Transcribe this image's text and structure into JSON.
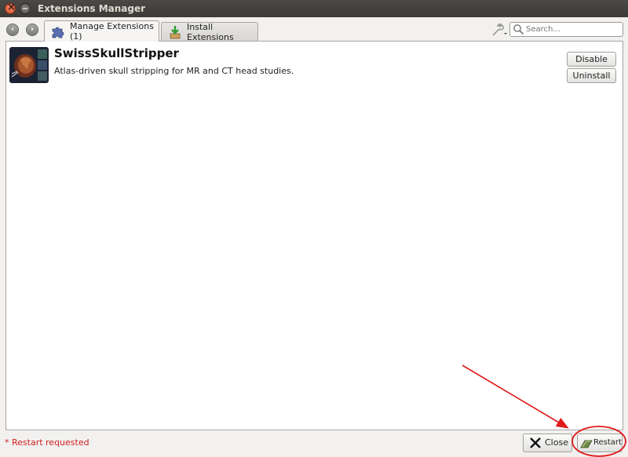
{
  "window": {
    "title": "Extensions Manager"
  },
  "tabs": [
    {
      "label": "Manage Extensions (1)",
      "icon": "puzzle-icon",
      "active": true
    },
    {
      "label": "Install Extensions",
      "icon": "install-icon",
      "active": false
    }
  ],
  "search": {
    "placeholder": "Search...",
    "value": ""
  },
  "extension": {
    "name": "SwissSkullStripper",
    "description": "Atlas-driven skull stripping for MR and CT head studies.",
    "disable_label": "Disable",
    "uninstall_label": "Uninstall"
  },
  "footer": {
    "restart_message": "* Restart requested",
    "close_label": "Close",
    "restart_label": "Restart"
  },
  "colors": {
    "annotation": "#e01b1b",
    "restart_message": "#d21f1f",
    "titlebar": "#3c3b37"
  }
}
